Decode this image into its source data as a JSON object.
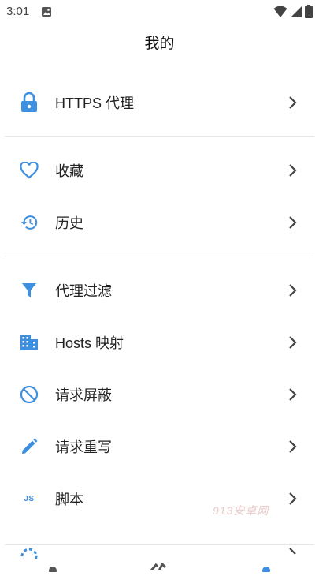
{
  "status_bar": {
    "time": "3:01"
  },
  "header": {
    "title": "我的"
  },
  "menu": {
    "https_proxy": "HTTPS 代理",
    "favorites": "收藏",
    "history": "历史",
    "proxy_filter": "代理过滤",
    "hosts_mapping": "Hosts 映射",
    "request_block": "请求屏蔽",
    "request_rewrite": "请求重写",
    "script": "脚本",
    "script_badge": "JS"
  },
  "watermark": "913安卓网",
  "colors": {
    "accent": "#3d8fe0",
    "divider": "#e6e6e6",
    "chevron": "#444444"
  }
}
